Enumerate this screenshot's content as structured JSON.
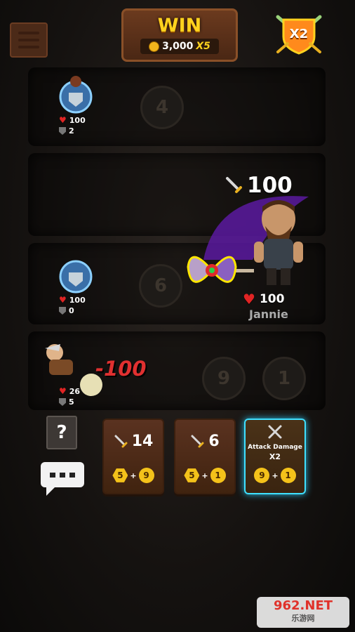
{
  "header": {
    "win_title": "WIN",
    "reward_amount": "3,000",
    "reward_multiplier": "X5",
    "bonus_badge": "X2"
  },
  "floors": [
    {
      "hole_number": "4"
    },
    {
      "hole_number": "6"
    },
    {
      "hole_number": "9"
    },
    {
      "hole_number": "1"
    }
  ],
  "heroes": [
    {
      "hp": "100",
      "armor": "2"
    },
    {
      "hp": "100",
      "armor": "0"
    },
    {
      "hp": "26",
      "armor": "5"
    }
  ],
  "enemy": {
    "name": "Jannie",
    "damage": "100",
    "hp": "100"
  },
  "damage_popup": "-100",
  "help_label": "?",
  "cards": [
    {
      "value": "14",
      "cost_a": "5",
      "cost_b": "9"
    },
    {
      "value": "6",
      "cost_a": "5",
      "cost_b": "1"
    },
    {
      "title": "Attack Damage",
      "multiplier": "X2",
      "cost_a": "9",
      "cost_b": "1"
    }
  ],
  "watermark": {
    "brand": "962.NET",
    "sub": "乐游网"
  },
  "colors": {
    "accent_gold": "#ffd21e",
    "damage_red": "#e03030",
    "special_card_glow": "#3fe0ff",
    "enemy_aura": "#6a1fb0"
  }
}
